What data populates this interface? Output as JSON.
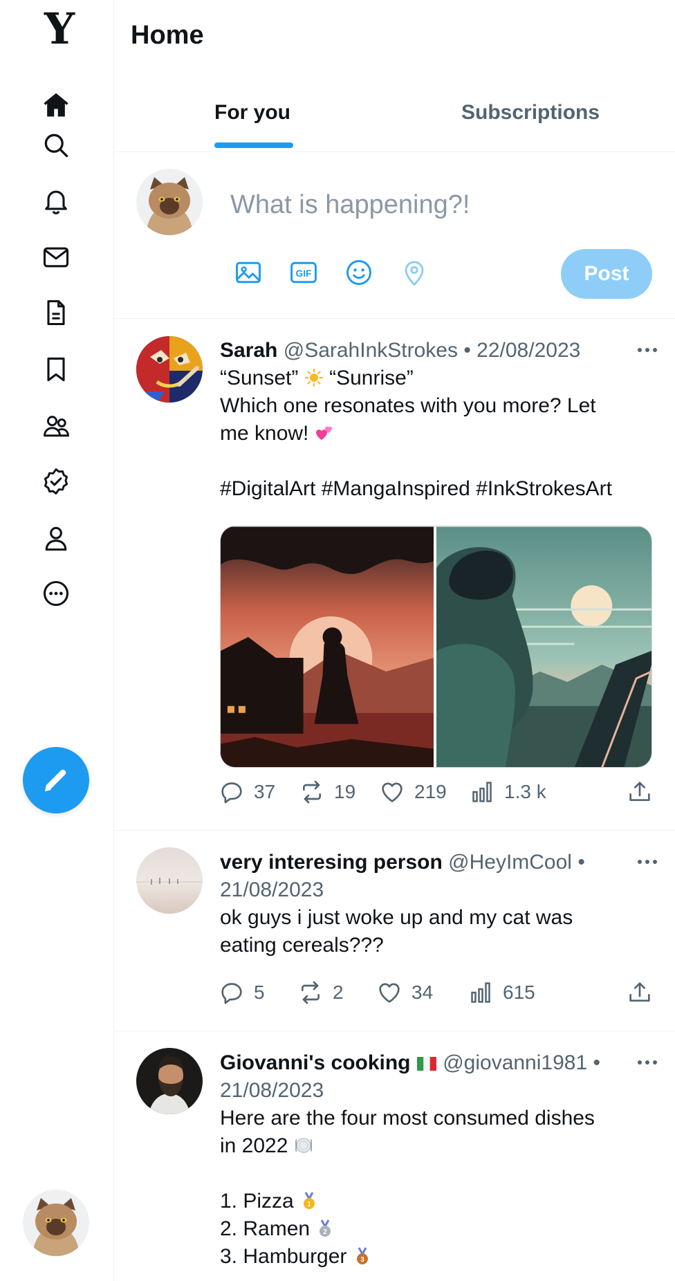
{
  "app": {
    "logo": "Y"
  },
  "sidebar": {
    "items": [
      {
        "name": "home",
        "icon": "home-icon"
      },
      {
        "name": "explore",
        "icon": "search-icon"
      },
      {
        "name": "notifications",
        "icon": "bell-icon"
      },
      {
        "name": "messages",
        "icon": "mail-icon"
      },
      {
        "name": "lists",
        "icon": "document-icon"
      },
      {
        "name": "bookmarks",
        "icon": "bookmark-icon"
      },
      {
        "name": "communities",
        "icon": "people-icon"
      },
      {
        "name": "verified",
        "icon": "verified-badge-icon"
      },
      {
        "name": "profile",
        "icon": "user-icon"
      },
      {
        "name": "more",
        "icon": "more-circle-icon"
      }
    ],
    "compose_icon": "pencil-icon"
  },
  "header": {
    "title": "Home"
  },
  "tabs": [
    {
      "label": "For you",
      "active": true
    },
    {
      "label": "Subscriptions",
      "active": false
    }
  ],
  "composer": {
    "placeholder": "What is happening?!",
    "value": "",
    "tools": [
      "image-icon",
      "gif-icon",
      "emoji-icon",
      "location-icon"
    ],
    "post_label": "Post"
  },
  "posts": [
    {
      "name": "Sarah",
      "handle": "@SarahInkStrokes",
      "separator": "•",
      "date": "22/08/2023",
      "text_line1_a": "“Sunset”",
      "text_line1_b": "“Sunrise”",
      "text_rest": "Which one resonates with you more? Let\nme know!",
      "hashtags": "#DigitalArt #MangaInspired #InkStrokesArt",
      "stats": {
        "replies": "37",
        "reposts": "19",
        "likes": "219",
        "views": "1.3 k"
      }
    },
    {
      "name": "very interesing person",
      "handle": "@HeyImCool",
      "separator": "•",
      "date": "21/08/2023",
      "text": "ok guys i just woke up and my cat was\neating cereals???",
      "stats": {
        "replies": "5",
        "reposts": "2",
        "likes": "34",
        "views": "615"
      }
    },
    {
      "name": "Giovanni's cooking",
      "handle": "@giovanni1981",
      "separator": "•",
      "date": "21/08/2023",
      "text_intro": "Here are the four most consumed dishes\nin 2022",
      "list": [
        "1. Pizza",
        "2. Ramen",
        "3. Hamburger"
      ]
    }
  ],
  "colors": {
    "accent": "#1d9bf0",
    "post_button_disabled": "#8ecdf8",
    "secondary_text": "#536471"
  }
}
